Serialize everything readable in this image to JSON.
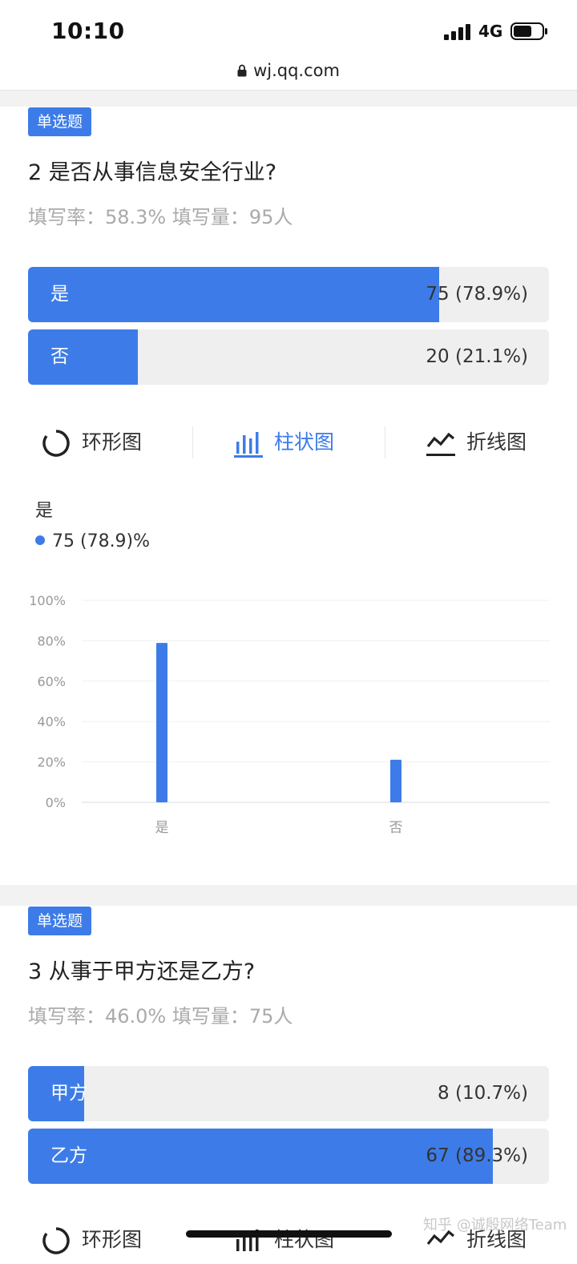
{
  "status_bar": {
    "time": "10:10",
    "network": "4G"
  },
  "url_bar": {
    "url": "wj.qq.com"
  },
  "question2": {
    "tag": "单选题",
    "title": "2 是否从事信息安全行业?",
    "meta": "填写率：58.3%   填写量：95人",
    "options": [
      {
        "label": "是",
        "value_text": "75 (78.9%)",
        "percent": 78.9
      },
      {
        "label": "否",
        "value_text": "20 (21.1%)",
        "percent": 21.1
      }
    ],
    "chart_tabs": [
      {
        "label": "环形图",
        "icon": "ring-chart-icon",
        "active": false
      },
      {
        "label": "柱状图",
        "icon": "bar-chart-icon",
        "active": true
      },
      {
        "label": "折线图",
        "icon": "line-chart-icon",
        "active": false
      }
    ],
    "tooltip": {
      "title": "是",
      "value": "75 (78.9)%"
    }
  },
  "question3": {
    "tag": "单选题",
    "title": "3 从事于甲方还是乙方?",
    "meta": "填写率：46.0%   填写量：75人",
    "options": [
      {
        "label": "甲方",
        "value_text": "8 (10.7%)",
        "percent": 10.7
      },
      {
        "label": "乙方",
        "value_text": "67 (89.3%)",
        "percent": 89.3
      }
    ],
    "chart_tabs": [
      {
        "label": "环形图",
        "icon": "ring-chart-icon",
        "active": false
      },
      {
        "label": "柱状图",
        "icon": "bar-chart-icon",
        "active": false
      },
      {
        "label": "折线图",
        "icon": "line-chart-icon",
        "active": false
      }
    ]
  },
  "chart_data": {
    "type": "bar",
    "categories": [
      "是",
      "否"
    ],
    "values": [
      78.9,
      21.1
    ],
    "ylim": [
      0,
      100
    ],
    "yticks": [
      "0%",
      "20%",
      "40%",
      "60%",
      "80%",
      "100%"
    ],
    "grid": true,
    "color": "#3d7ce8"
  },
  "watermark": "知乎 @诚殷网络Team",
  "colors": {
    "accent": "#3d7ce8",
    "track": "#efefef",
    "muted": "#aaaaaa"
  }
}
